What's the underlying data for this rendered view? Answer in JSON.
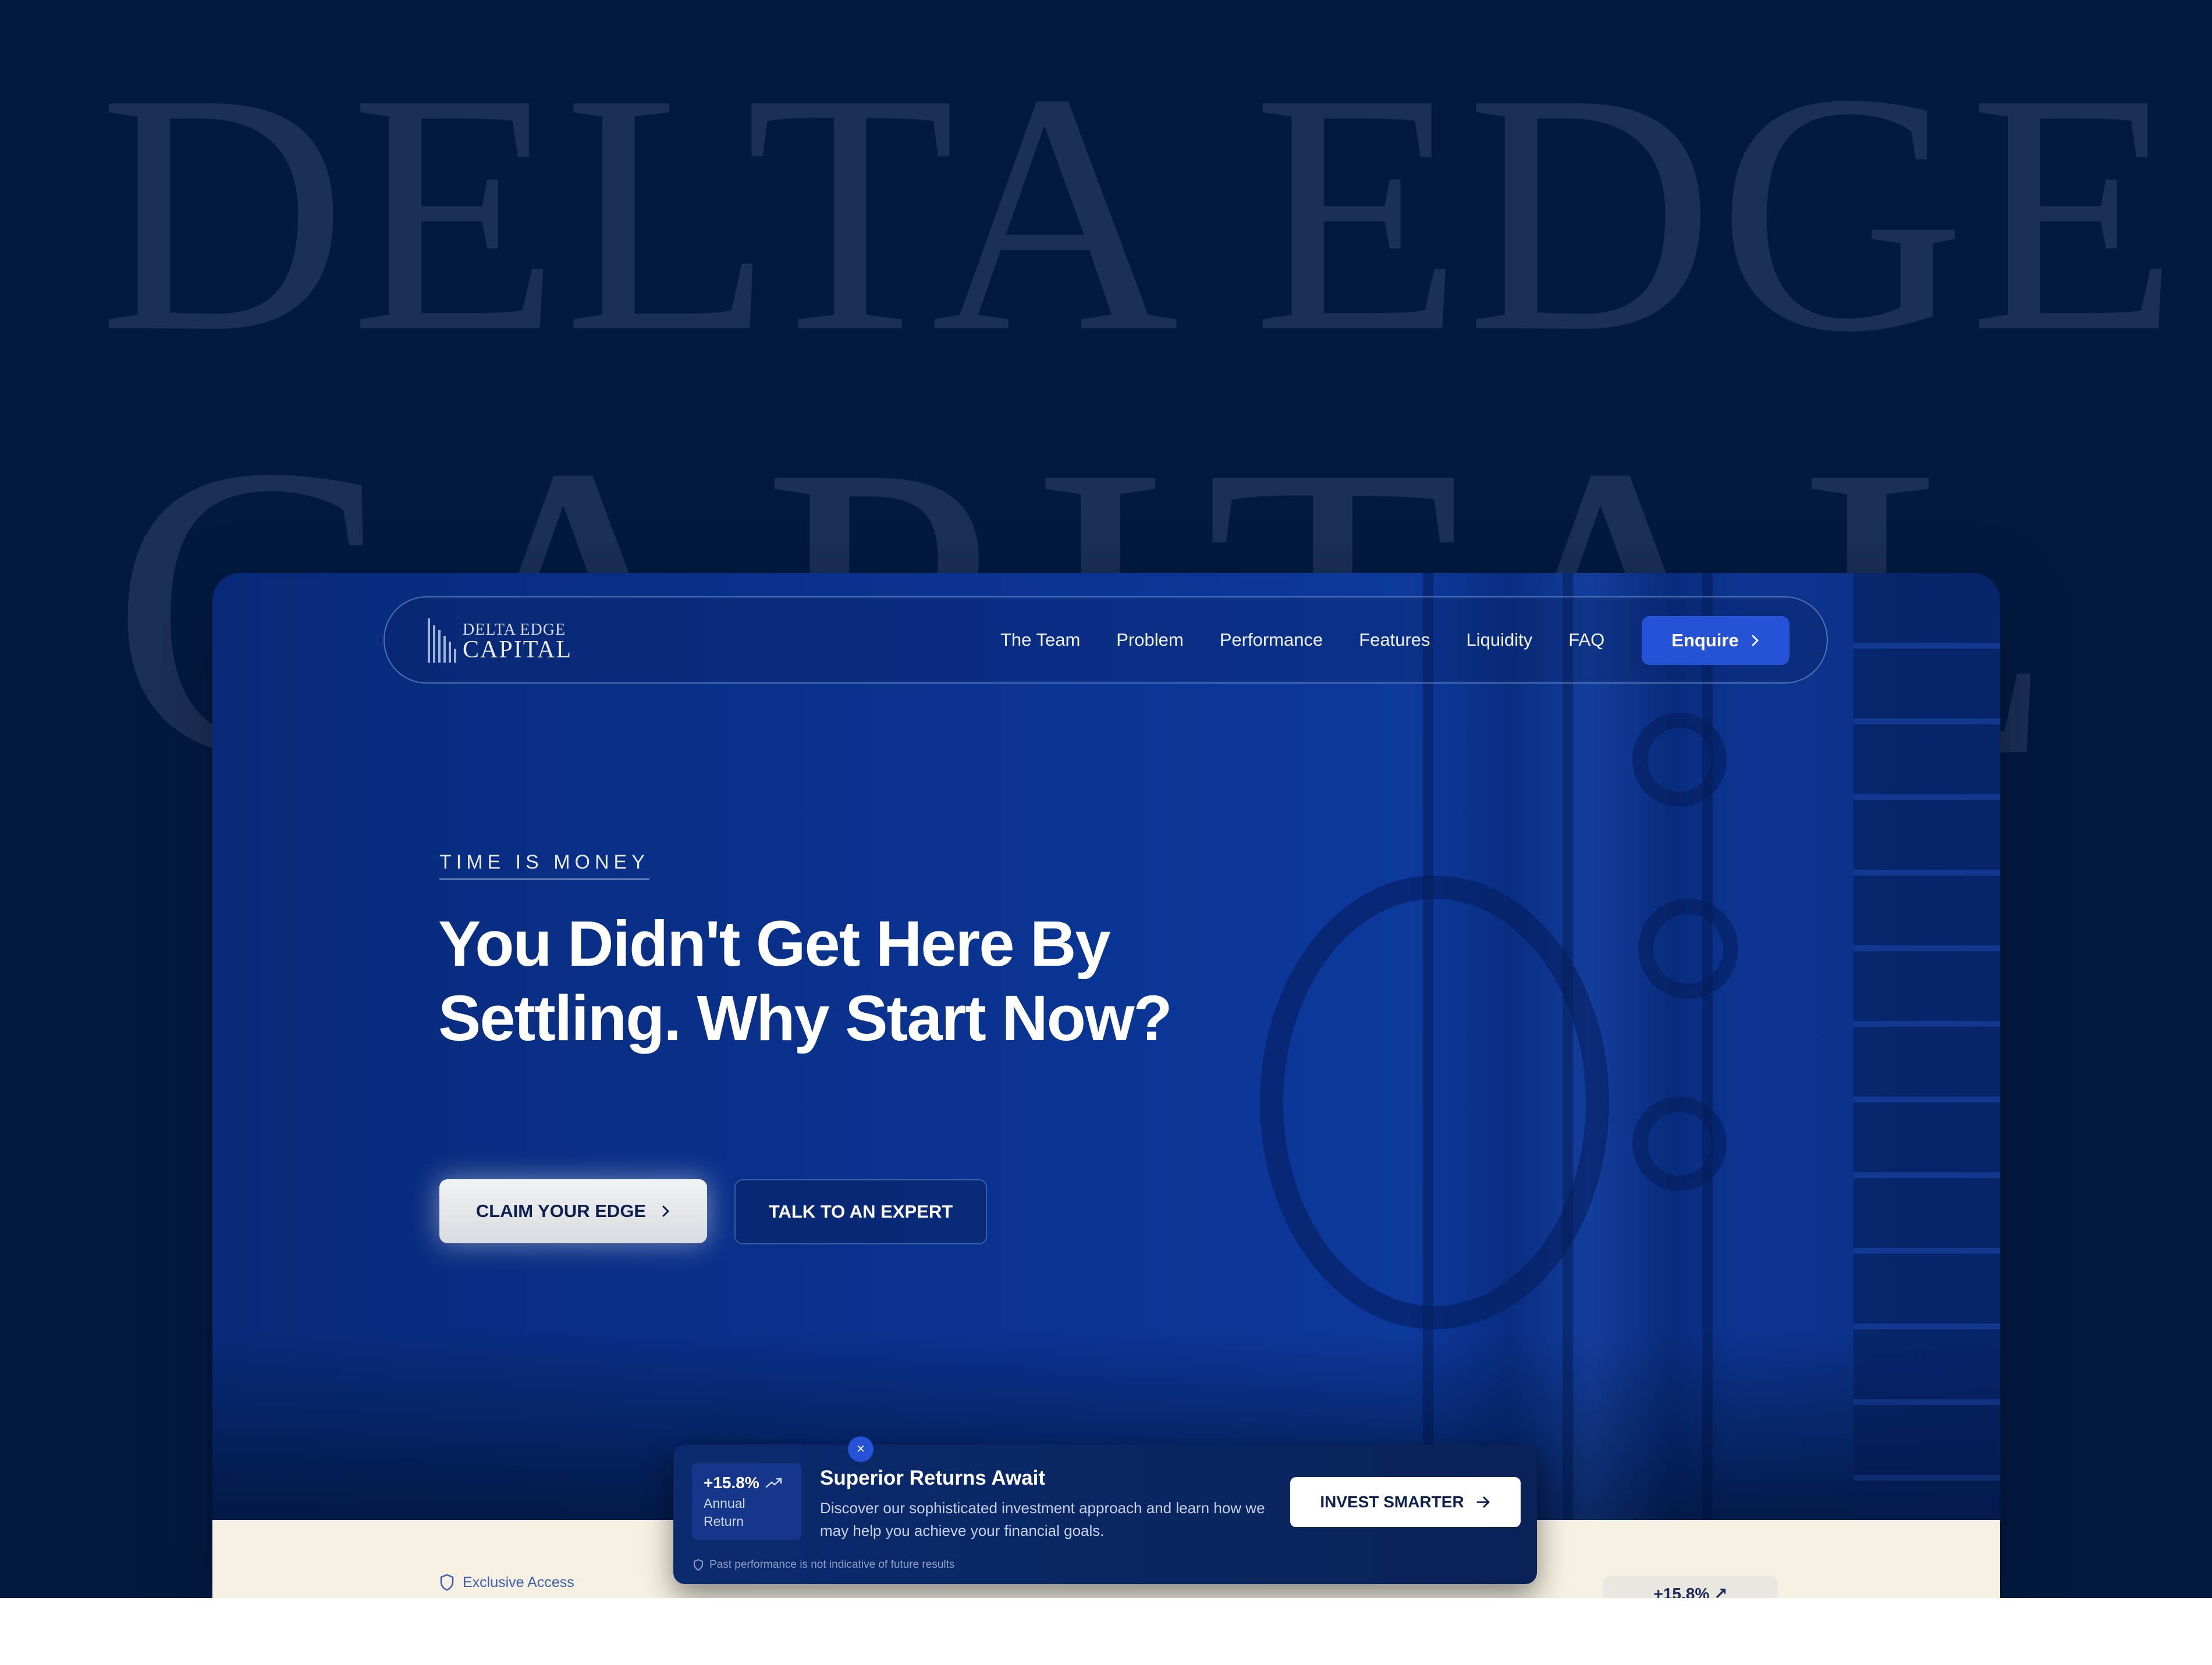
{
  "background": {
    "line1": "DELTA EDGE",
    "line2": "CAPITAL"
  },
  "nav": {
    "logo_top": "DELTA EDGE",
    "logo_bottom": "CAPITAL",
    "links": [
      "The Team",
      "Problem",
      "Performance",
      "Features",
      "Liquidity",
      "FAQ"
    ],
    "enquire_label": "Enquire"
  },
  "hero": {
    "eyebrow": "TIME IS MONEY",
    "headline": "You Didn't Get Here By Settling. Why Start Now?",
    "primary_cta": "CLAIM YOUR EDGE",
    "secondary_cta": "TALK TO AN EXPERT"
  },
  "cream": {
    "exclusive_label": "Exclusive Access",
    "peek_stat": "+15.8% ↗"
  },
  "popup": {
    "stat_value": "+15.8%",
    "stat_label_1": "Annual",
    "stat_label_2": "Return",
    "title": "Superior Returns Await",
    "body": "Discover our sophisticated investment approach and learn how we may help you achieve your financial goals.",
    "cta_label": "INVEST SMARTER",
    "disclaimer": "Past performance is not indicative of future results",
    "close_symbol": "×"
  },
  "colors": {
    "page_bg": "#021a42",
    "accent": "#2552d6",
    "cream": "#f6f0e2"
  }
}
